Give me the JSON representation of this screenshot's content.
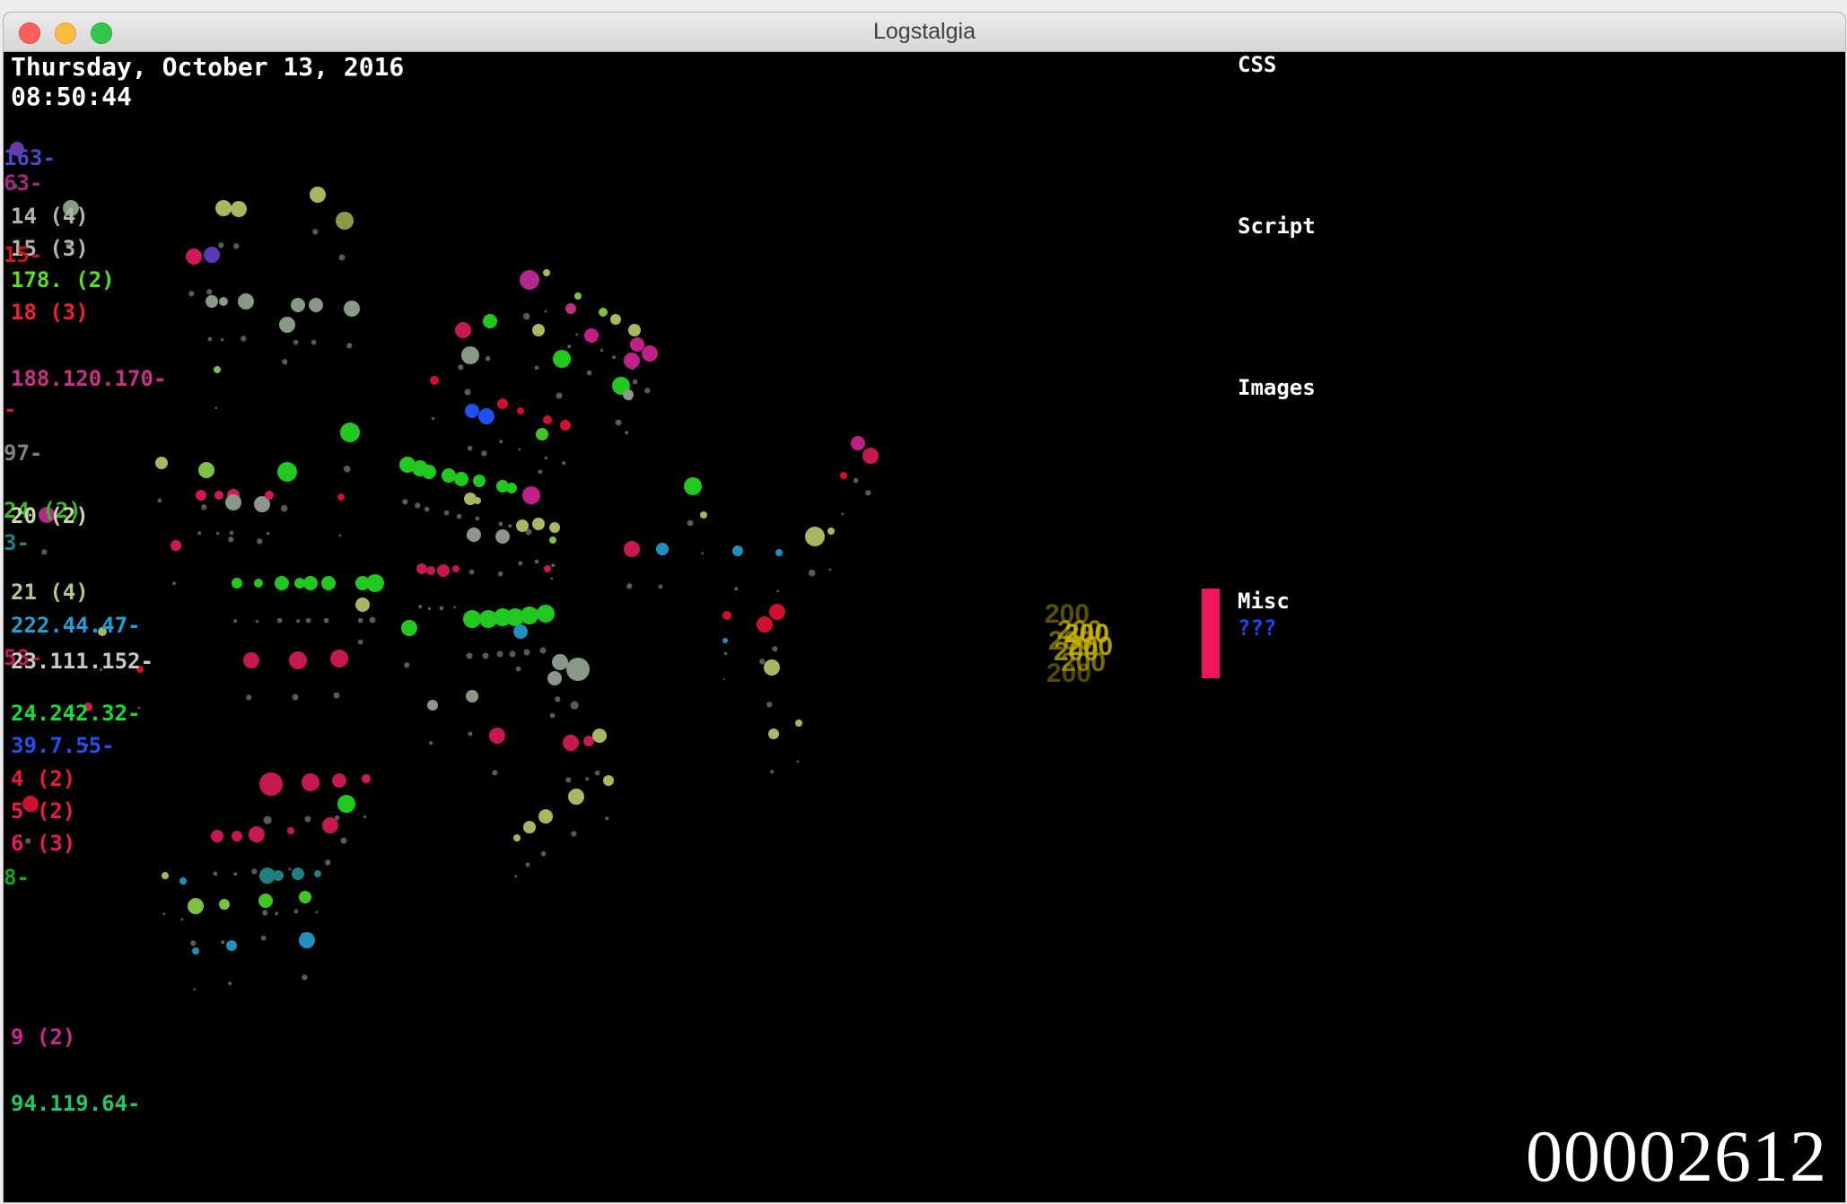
{
  "window": {
    "title": "Logstalgia"
  },
  "clock": {
    "date": "Thursday, October 13, 2016",
    "time": "08:50:44"
  },
  "hosts": [
    {
      "label": "163-",
      "color": "#4a4ac8"
    },
    {
      "label": "63-",
      "color": "#a0287a"
    },
    {
      "label": "14 (4)",
      "color": "#b0b8a0"
    },
    {
      "label": "15 (3)",
      "color": "#b0b8a8"
    },
    {
      "label": "15-",
      "color": "#c81818"
    },
    {
      "label": "178. (2)",
      "color": "#58e020"
    },
    {
      "label": "18 (3)",
      "color": "#f02030"
    },
    {
      "label": "188.120.170-",
      "color": "#c83088"
    },
    {
      "label": "-",
      "color": "#d0183c"
    },
    {
      "label": "97-",
      "color": "#808080"
    },
    {
      "label": "24 (2)",
      "color": "#40b820"
    },
    {
      "label": "20 (2)",
      "color": "#c8d8a8"
    },
    {
      "label": "3-",
      "color": "#208080"
    },
    {
      "label": "21 (4)",
      "color": "#b0c890"
    },
    {
      "label": "222.44.47-",
      "color": "#20a0d8"
    },
    {
      "label": "58-",
      "color": "#c01858"
    },
    {
      "label": "23.111.152-",
      "color": "#c8c8c8"
    },
    {
      "label": "24.242.32-",
      "color": "#10e030"
    },
    {
      "label": "39.7.55-",
      "color": "#2050f0"
    },
    {
      "label": "4 (2)",
      "color": "#f01830"
    },
    {
      "label": "5 (2)",
      "color": "#f01848"
    },
    {
      "label": "6 (3)",
      "color": "#e81860"
    },
    {
      "label": "8-",
      "color": "#10a818"
    },
    {
      "label": "9 (2)",
      "color": "#c82890"
    },
    {
      "label": "94.119.64-",
      "color": "#20c860"
    }
  ],
  "categories": [
    {
      "label": "CSS"
    },
    {
      "label": "Script"
    },
    {
      "label": "Images"
    },
    {
      "label": "Misc",
      "sub": "???"
    }
  ],
  "response_code": "200",
  "request_counter": "00002612",
  "colors": {
    "misc_paddle": "#f0155a",
    "code_text": "#c8b400",
    "unknown_text": "#2244ee"
  }
}
